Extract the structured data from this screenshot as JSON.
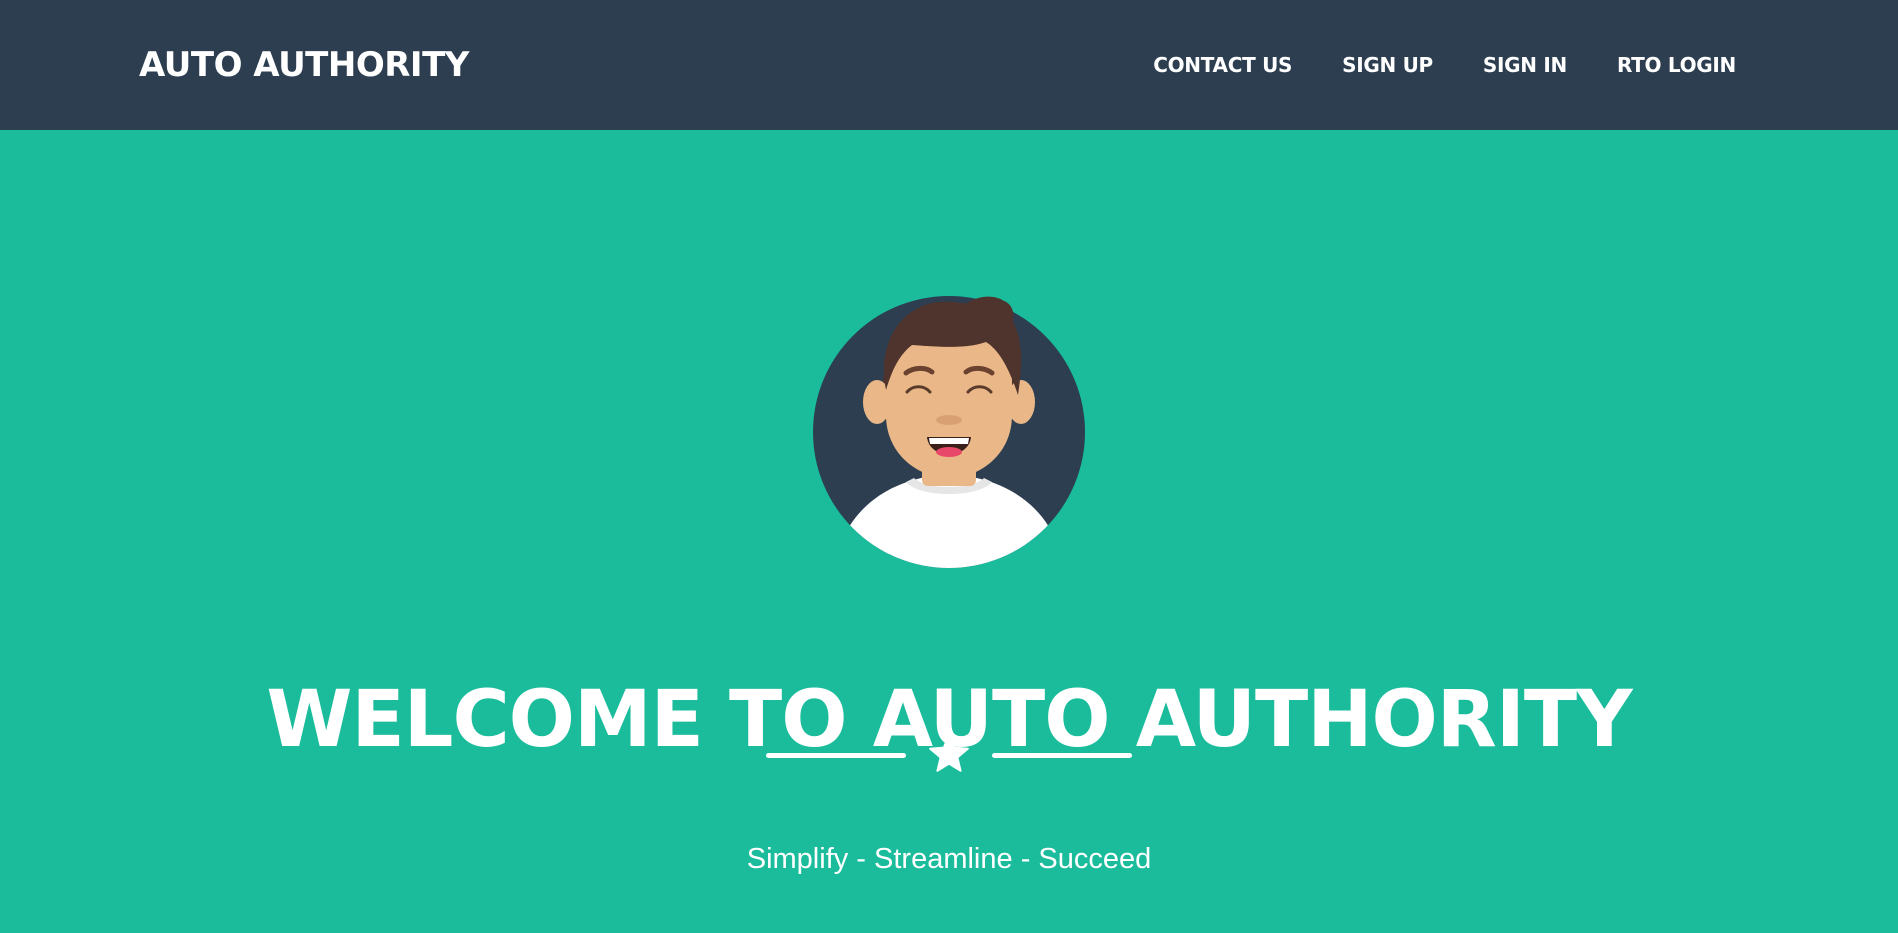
{
  "header": {
    "brand": "AUTO AUTHORITY",
    "nav": [
      {
        "label": "CONTACT US"
      },
      {
        "label": "SIGN UP"
      },
      {
        "label": "SIGN IN"
      },
      {
        "label": "RTO LOGIN"
      }
    ]
  },
  "hero": {
    "avatar_icon": "smiling-man-avatar-icon",
    "title": "WELCOME TO AUTO AUTHORITY",
    "divider_icon": "star-icon",
    "subtitle": "Simplify - Streamline - Succeed"
  },
  "colors": {
    "navbar": "#2c3e50",
    "hero_background": "#1abc9c",
    "text": "#ffffff"
  }
}
